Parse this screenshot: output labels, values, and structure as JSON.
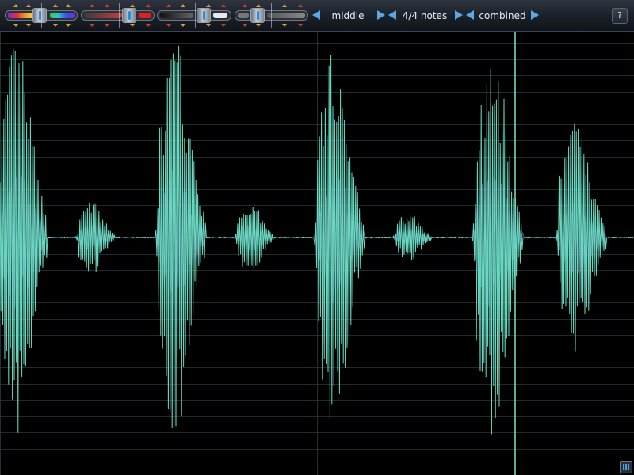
{
  "toolbar": {
    "nav": {
      "position_label": "middle",
      "notes_label": "4/4 notes",
      "mode_label": "combined"
    },
    "help_label": "?"
  },
  "colors": {
    "waveform": "#69d8c0",
    "waveform_accent": "#8a8ae6",
    "grid": "#2a3a40",
    "cursor": "#7fe4c6",
    "toolbar_bg": "#1d232c",
    "accent_arrow": "#5aa6e6"
  },
  "waveform": {
    "bursts": [
      {
        "center": 30,
        "width": 60,
        "amp": 0.93
      },
      {
        "center": 122,
        "width": 45,
        "amp": 0.18
      },
      {
        "center": 230,
        "width": 60,
        "amp": 0.93
      },
      {
        "center": 322,
        "width": 45,
        "amp": 0.18
      },
      {
        "center": 430,
        "width": 60,
        "amp": 0.9
      },
      {
        "center": 522,
        "width": 45,
        "amp": 0.12
      },
      {
        "center": 630,
        "width": 60,
        "amp": 0.93
      },
      {
        "center": 735,
        "width": 60,
        "amp": 0.55
      }
    ]
  }
}
